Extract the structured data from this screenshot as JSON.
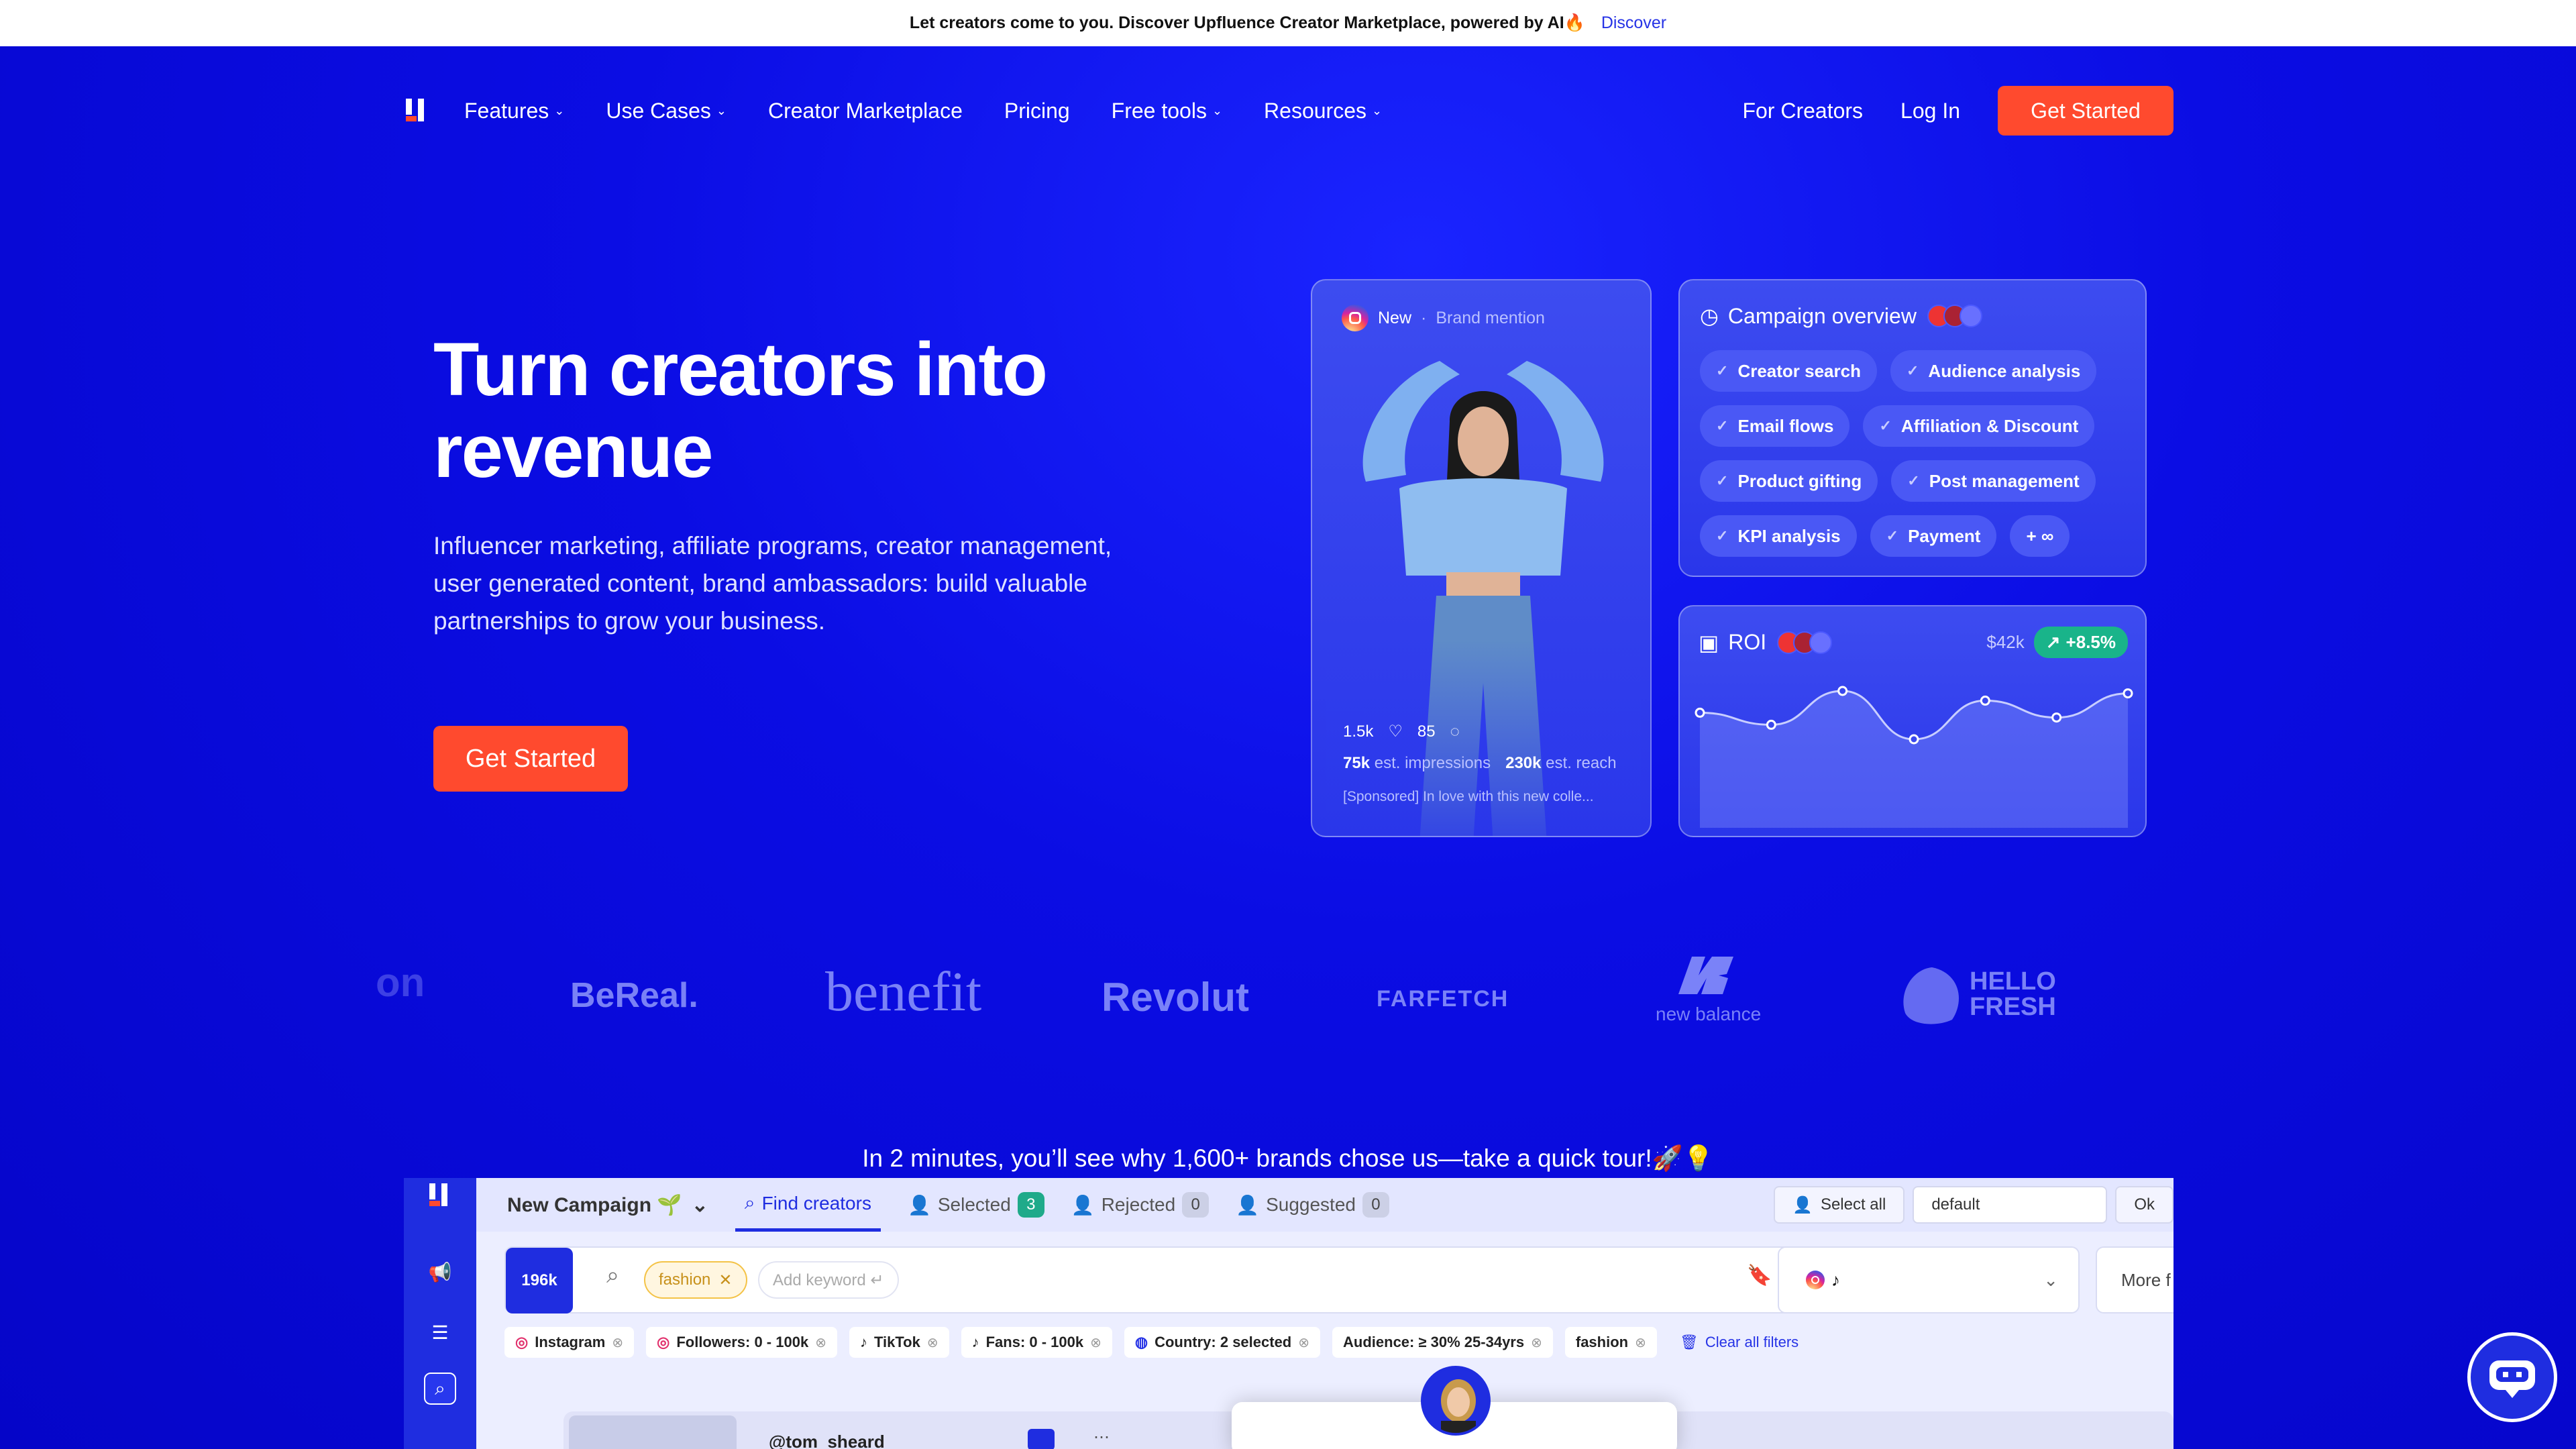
{
  "announcement": {
    "text": "Let creators come to you. Discover Upfluence Creator Marketplace, powered by AI🔥",
    "link": "Discover"
  },
  "nav": {
    "items": [
      "Features",
      "Use Cases",
      "Creator Marketplace",
      "Pricing",
      "Free tools",
      "Resources"
    ],
    "for_creators": "For Creators",
    "login": "Log In",
    "cta": "Get Started"
  },
  "hero": {
    "title": "Turn creators into revenue",
    "subtitle": "Influencer marketing, affiliate programs, creator management, user generated content, brand ambassadors: build valuable partnerships to grow your business.",
    "cta": "Get Started"
  },
  "post_card": {
    "tag": "New",
    "type": "Brand mention",
    "likes": "1.5k",
    "comments": "85",
    "impressions_value": "75k",
    "impressions_label": "est. impressions",
    "reach_value": "230k",
    "reach_label": "est. reach",
    "caption": "[Sponsored] In love with this new colle..."
  },
  "campaign_overview": {
    "title": "Campaign overview",
    "chips": [
      "Creator search",
      "Audience analysis",
      "Email flows",
      "Affiliation & Discount",
      "Product gifting",
      "Post management",
      "KPI analysis",
      "Payment",
      "+ ∞"
    ]
  },
  "roi": {
    "title": "ROI",
    "value": "$42k",
    "change": "+8.5%",
    "series": [
      62,
      52,
      80,
      40,
      72,
      58,
      78
    ]
  },
  "brand_logos": [
    "on",
    "BeReal.",
    "benefit",
    "Revolut",
    "FARFETCH",
    "new balance",
    "HELLO FRESH"
  ],
  "tour_text": "In 2 minutes, you’ll see why 1,600+ brands chose us—take a quick tour!🚀💡",
  "app": {
    "campaign": "New Campaign 🌱",
    "tabs": [
      {
        "label": "Find creators",
        "count": ""
      },
      {
        "label": "Selected",
        "count": "3"
      },
      {
        "label": "Rejected",
        "count": "0"
      },
      {
        "label": "Suggested",
        "count": "0"
      }
    ],
    "select_all": "Select all",
    "sort_value": "default",
    "ok": "Ok",
    "results": "196k",
    "keyword": "fashion",
    "keyword_placeholder": "Add keyword ↵",
    "more_filters": "More f",
    "filters": [
      "Instagram",
      "Followers: 0 - 100k",
      "TikTok",
      "Fans: 0 - 100k",
      "Country: 2 selected",
      "Audience: ≥ 30% 25-34yrs",
      "fashion"
    ],
    "clear_filters": "Clear all filters",
    "creator_handle": "@tom_sheard"
  }
}
